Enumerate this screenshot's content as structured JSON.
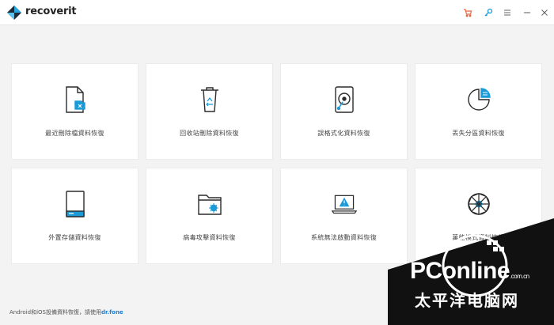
{
  "app": {
    "brand": "recoverit"
  },
  "titlebar": {
    "icons": [
      "cart-icon",
      "key-icon",
      "menu-icon",
      "minimize-icon",
      "close-icon"
    ]
  },
  "cards": [
    {
      "label": "最近刪除檔資料恢復",
      "icon": "deleted-file-icon"
    },
    {
      "label": "回收站刪除資料恢復",
      "icon": "recycle-bin-icon"
    },
    {
      "label": "誤格式化資料恢復",
      "icon": "formatted-drive-icon"
    },
    {
      "label": "丟失分區資料恢復",
      "icon": "lost-partition-icon"
    },
    {
      "label": "外置存儲資料恢復",
      "icon": "external-device-icon"
    },
    {
      "label": "病毒攻擊資料恢復",
      "icon": "virus-folder-icon"
    },
    {
      "label": "系統無法啟動資料恢復",
      "icon": "system-crash-icon"
    },
    {
      "label": "萬能模式資料恢復",
      "icon": "all-around-icon"
    }
  ],
  "footer": {
    "text": "Android和iOS設備資料恢復，請使用",
    "link": "dr.fone"
  },
  "watermark": {
    "brand": "PConline",
    "domain": ".com.cn",
    "tagline": "太平洋电脑网"
  },
  "colors": {
    "accent": "#1a9bd7",
    "cart": "#e8663d",
    "icon_stroke": "#2b2b2b"
  }
}
